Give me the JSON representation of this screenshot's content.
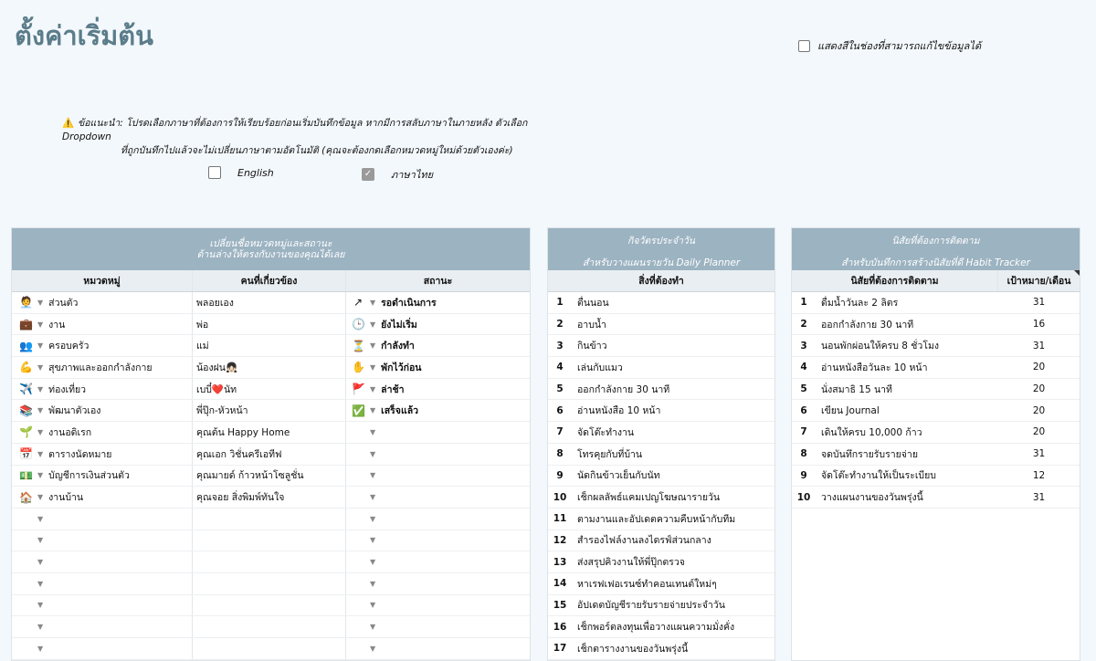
{
  "page": {
    "title": "ตั้งค่าเริ่มต้น",
    "show_editable_label": "แสดงสีในช่องที่สามารถแก้ไขข้อมูลได้",
    "notice_line1": "ข้อแนะนำ: โปรดเลือกภาษาที่ต้องการให้เรียบร้อยก่อนเริ่มบันทึกข้อมูล หากมีการสลับภาษาในภายหลัง ตัวเลือก Dropdown",
    "notice_line2": "ที่ถูกบันทึกไปแล้วจะไม่เปลี่ยนภาษาตามอัตโนมัติ (คุณจะต้องกดเลือกหมวดหมู่ใหม่ด้วยตัวเองค่ะ)",
    "lang_english": "English",
    "lang_thai": "ภาษาไทย"
  },
  "categories_panel": {
    "header_line1": "เปลี่ยนชื่อหมวดหมู่และสถานะ",
    "header_line2": "ด้านล่างให้ตรงกับงานของคุณได้เลย",
    "col_category": "หมวดหมู่",
    "col_person": "คนที่เกี่ยวข้อง",
    "col_status": "สถานะ",
    "rows": [
      {
        "icon": "🧑‍💼",
        "category": "ส่วนตัว",
        "person": "พลอยเอง",
        "s_icon": "↗",
        "status": "รอดำเนินการ"
      },
      {
        "icon": "💼",
        "category": "งาน",
        "person": "พ่อ",
        "s_icon": "🕒",
        "status": "ยังไม่เริ่ม"
      },
      {
        "icon": "👥",
        "category": "ครอบครัว",
        "person": "แม่",
        "s_icon": "⏳",
        "status": "กำลังทำ"
      },
      {
        "icon": "💪",
        "category": "สุขภาพและออกกำลังกาย",
        "person": "น้องฝน👧🏻",
        "s_icon": "✋",
        "status": "พักไว้ก่อน"
      },
      {
        "icon": "✈️",
        "category": "ท่องเที่ยว",
        "person": "เบบี๋❤️นัท",
        "s_icon": "🚩",
        "status": "ล่าช้า"
      },
      {
        "icon": "📚",
        "category": "พัฒนาตัวเอง",
        "person": "พี่ปุ๊ก-หัวหน้า",
        "s_icon": "✅",
        "status": "เสร็จแล้ว"
      },
      {
        "icon": "🌱",
        "category": "งานอดิเรก",
        "person": "คุณต้น Happy Home",
        "s_icon": "",
        "status": ""
      },
      {
        "icon": "📅",
        "category": "ตารางนัดหมาย",
        "person": "คุณเอก วิชั่นครีเอทีฟ",
        "s_icon": "",
        "status": ""
      },
      {
        "icon": "💵",
        "category": "บัญชีการเงินส่วนตัว",
        "person": "คุณมายด์ ก้าวหน้าโซลูชั่น",
        "s_icon": "",
        "status": ""
      },
      {
        "icon": "🏠",
        "category": "งานบ้าน",
        "person": "คุณจอย สิ่งพิมพ์ทันใจ",
        "s_icon": "",
        "status": ""
      },
      {
        "icon": "",
        "category": "",
        "person": "",
        "s_icon": "",
        "status": ""
      },
      {
        "icon": "",
        "category": "",
        "person": "",
        "s_icon": "",
        "status": ""
      },
      {
        "icon": "",
        "category": "",
        "person": "",
        "s_icon": "",
        "status": ""
      },
      {
        "icon": "",
        "category": "",
        "person": "",
        "s_icon": "",
        "status": ""
      },
      {
        "icon": "",
        "category": "",
        "person": "",
        "s_icon": "",
        "status": ""
      },
      {
        "icon": "",
        "category": "",
        "person": "",
        "s_icon": "",
        "status": ""
      },
      {
        "icon": "",
        "category": "",
        "person": "",
        "s_icon": "",
        "status": ""
      }
    ]
  },
  "daily_panel": {
    "header_line1": "กิจวัตรประจำวัน",
    "header_line2": "สำหรับวางแผนรายวัน   Daily Planner",
    "col_task": "สิ่งที่ต้องทำ",
    "rows": [
      {
        "n": "1",
        "task": "ตื่นนอน"
      },
      {
        "n": "2",
        "task": "อาบน้ำ"
      },
      {
        "n": "3",
        "task": "กินข้าว"
      },
      {
        "n": "4",
        "task": "เล่นกับแมว"
      },
      {
        "n": "5",
        "task": "ออกกำลังกาย 30 นาที"
      },
      {
        "n": "6",
        "task": "อ่านหนังสือ 10 หน้า"
      },
      {
        "n": "7",
        "task": "จัดโต๊ะทำงาน"
      },
      {
        "n": "8",
        "task": "โทรคุยกับที่บ้าน"
      },
      {
        "n": "9",
        "task": "นัดกินข้าวเย็นกับนัท"
      },
      {
        "n": "10",
        "task": "เช็กผลลัพธ์แคมเปญโฆษณารายวัน"
      },
      {
        "n": "11",
        "task": "ตามงานและอัปเดตความคืบหน้ากับทีม"
      },
      {
        "n": "12",
        "task": "สำรองไฟล์งานลงไดรฟ์ส่วนกลาง"
      },
      {
        "n": "13",
        "task": "ส่งสรุปคิวงานให้พี่ปุ๊กตรวจ"
      },
      {
        "n": "14",
        "task": "หาเรฟเฟอเรนซ์ทำคอนเทนต์ใหม่ๆ"
      },
      {
        "n": "15",
        "task": "อัปเดตบัญชีรายรับรายจ่ายประจำวัน"
      },
      {
        "n": "16",
        "task": "เช็กพอร์ตลงทุนเพื่อวางแผนความมั่งคั่ง"
      },
      {
        "n": "17",
        "task": "เช็กตารางงานของวันพรุ่งนี้"
      }
    ]
  },
  "habit_panel": {
    "header_line1": "นิสัยที่ต้องการติดตาม",
    "header_line2": "สำหรับบันทึกการสร้างนิสัยที่ดี   Habit Tracker",
    "col_habit": "นิสัยที่ต้องการติดตาม",
    "col_target": "เป้าหมาย/เดือน",
    "rows": [
      {
        "n": "1",
        "habit": "ดื่มน้ำวันละ 2 ลิตร",
        "target": "31"
      },
      {
        "n": "2",
        "habit": "ออกกำลังกาย 30 นาที",
        "target": "16"
      },
      {
        "n": "3",
        "habit": "นอนพักผ่อนให้ครบ 8 ชั่วโมง",
        "target": "31"
      },
      {
        "n": "4",
        "habit": "อ่านหนังสือวันละ 10 หน้า",
        "target": "20"
      },
      {
        "n": "5",
        "habit": "นั่งสมาธิ 15 นาที",
        "target": "20"
      },
      {
        "n": "6",
        "habit": "เขียน Journal",
        "target": "20"
      },
      {
        "n": "7",
        "habit": "เดินให้ครบ 10,000 ก้าว",
        "target": "20"
      },
      {
        "n": "8",
        "habit": "จดบันทึกรายรับรายจ่าย",
        "target": "31"
      },
      {
        "n": "9",
        "habit": "จัดโต๊ะทำงานให้เป็นระเบียบ",
        "target": "12"
      },
      {
        "n": "10",
        "habit": "วางแผนงานของวันพรุ่งนี้",
        "target": "31"
      }
    ]
  }
}
